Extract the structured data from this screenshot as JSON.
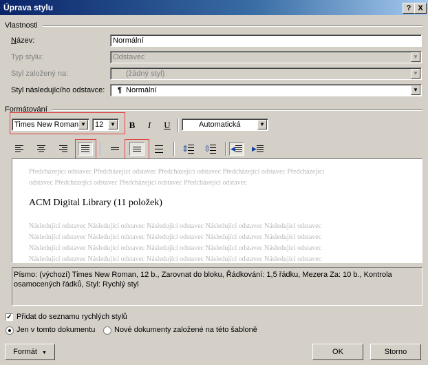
{
  "window": {
    "title": "Úprava stylu",
    "help_label": "?",
    "close_label": "X"
  },
  "properties": {
    "group_label": "Vlastnosti",
    "name_label": "Název:",
    "name_value": "Normální",
    "type_label": "Typ stylu:",
    "type_value": "Odstavec",
    "based_on_label": "Styl založený na:",
    "based_on_value": "(žádný styl)",
    "next_label": "Styl následujícího odstavce:",
    "next_value": "Normální",
    "next_icon": "¶"
  },
  "formatting": {
    "group_label": "Formátování",
    "font_name": "Times New Roman",
    "font_size": "12",
    "bold_label": "B",
    "italic_label": "I",
    "underline_label": "U",
    "color_value": "Automatická",
    "highlight_color": "#e04040"
  },
  "preview": {
    "previous_text": [
      "Předcházející odstavec Předcházející odstavec Předcházející odstavec Předcházející odstavec Předcházející",
      "odstavec Předcházející odstavec Předcházející odstavec Předcházející odstavec"
    ],
    "sample_text": "ACM Digital Library (11 položek)",
    "following_text": [
      "Následující odstavec Následující odstavec Následující odstavec Následující odstavec Následující odstavec",
      "Následující odstavec Následující odstavec Následující odstavec Následující odstavec Následující odstavec",
      "Následující odstavec Následující odstavec Následující odstavec Následující odstavec Následující odstavec",
      "Následující odstavec Následující odstavec Následující odstavec Následující odstavec Následující odstavec"
    ]
  },
  "description": "Písmo: (výchozí) Times New Roman, 12 b., Zarovnat do bloku, Řádkování: 1,5 řádku, Mezera Za: 10 b., Kontrola osamocených řádků, Styl: Rychlý styl",
  "options": {
    "add_quick_styles_label": "Přidat do seznamu rychlých stylů",
    "add_quick_styles_checked": true,
    "only_document_label": "Jen v tomto dokumentu",
    "new_documents_label": "Nové dokumenty založené na této šabloně"
  },
  "buttons": {
    "format_label": "Formát",
    "ok_label": "OK",
    "cancel_label": "Storno"
  }
}
